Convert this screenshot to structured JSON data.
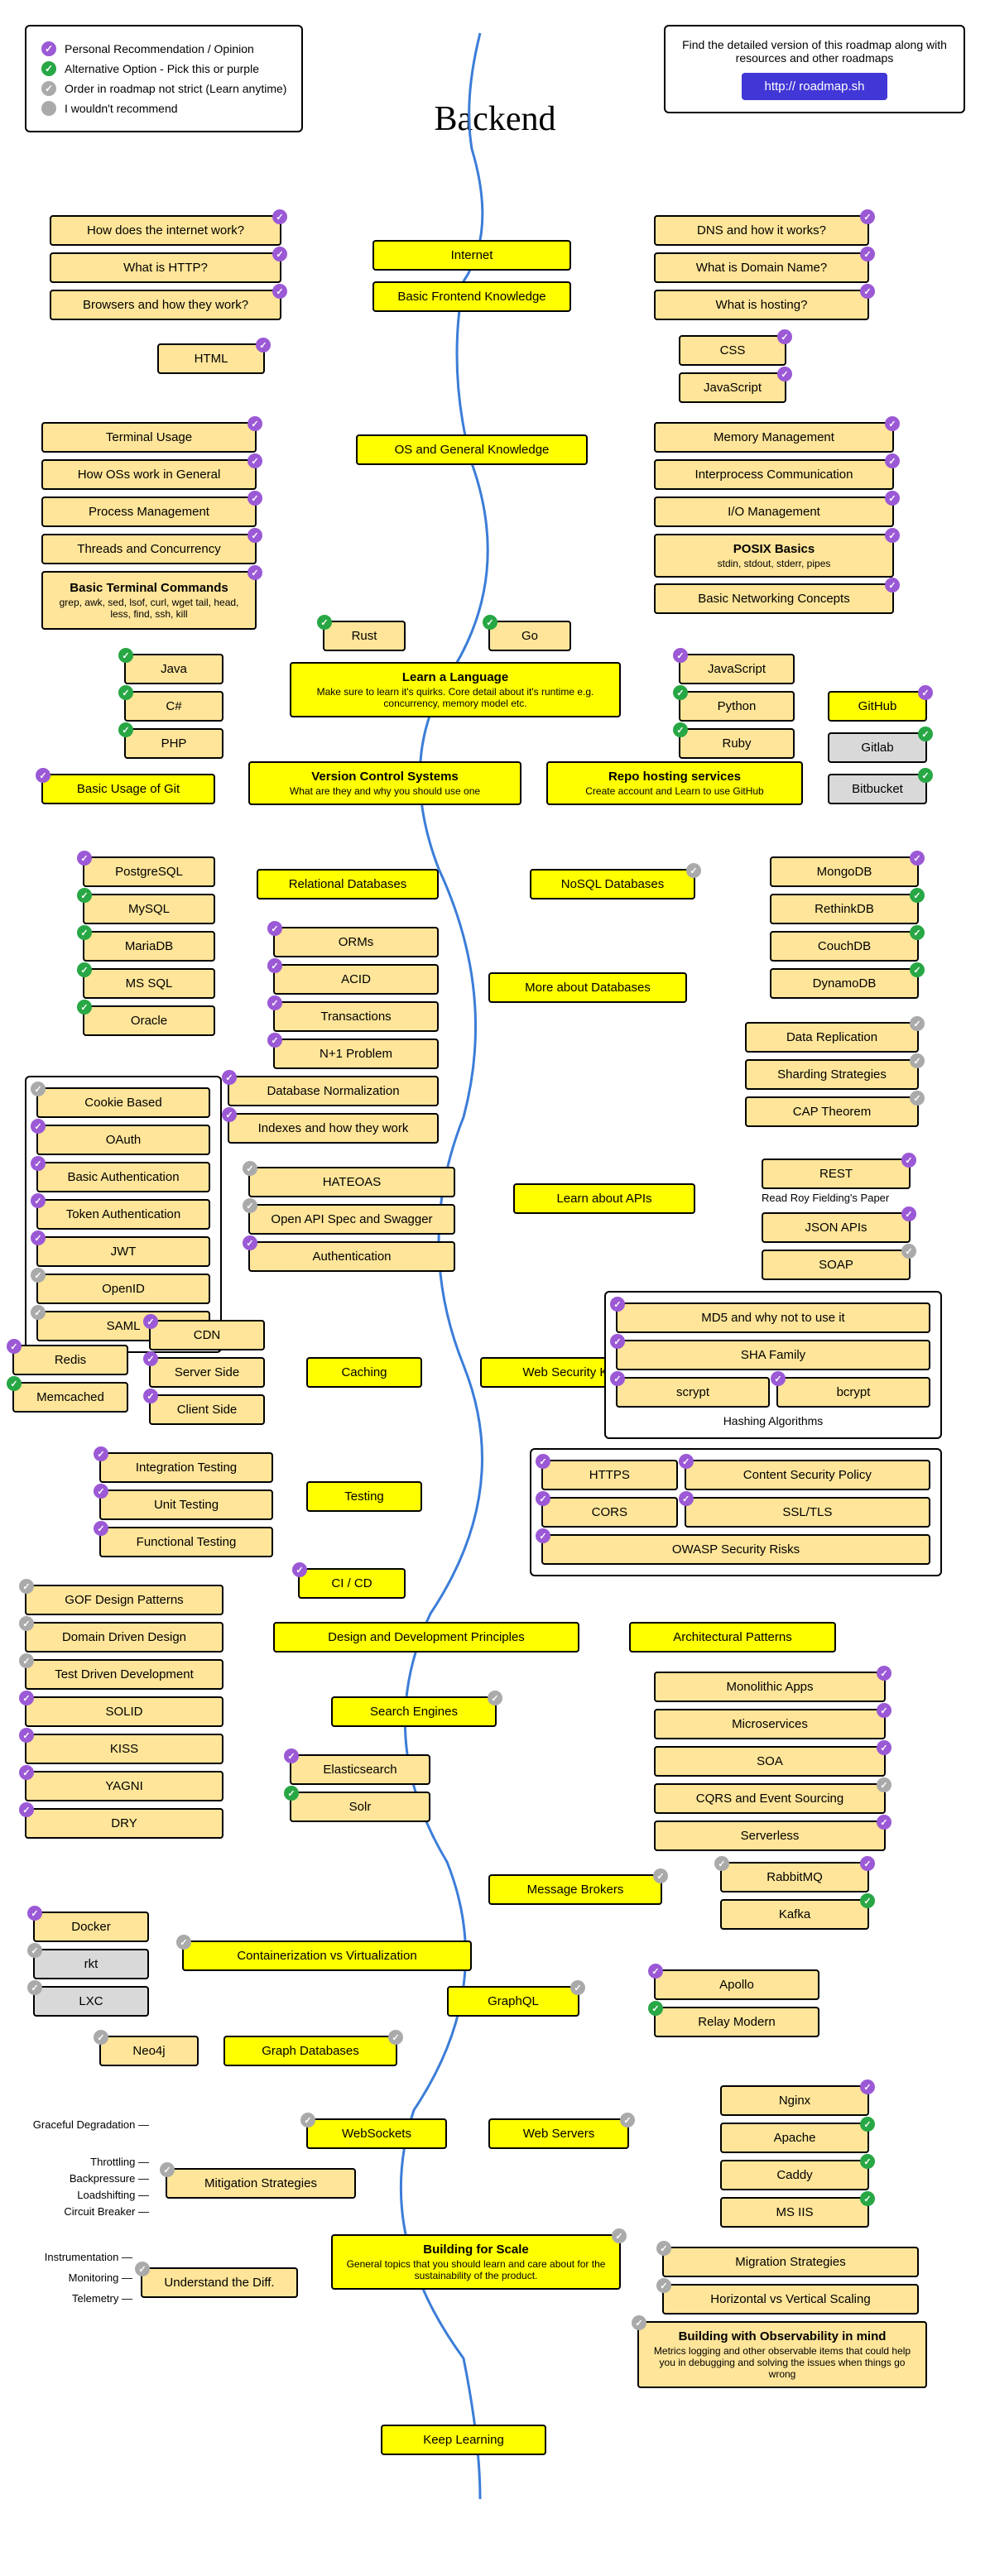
{
  "legend": {
    "items": [
      {
        "label": "Personal Recommendation / Opinion",
        "color": "purple"
      },
      {
        "label": "Alternative Option - Pick this or purple",
        "color": "green"
      },
      {
        "label": "Order in roadmap not strict (Learn anytime)",
        "color": "gray"
      },
      {
        "label": "I wouldn't recommend",
        "color": "gray"
      }
    ]
  },
  "info": {
    "text": "Find the detailed version of this roadmap along with resources and other roadmaps",
    "link": "http:// roadmap.sh"
  },
  "title": "Backend",
  "nodes": {
    "internet": "Internet",
    "how_internet": "How does the internet work?",
    "what_http": "What is HTTP?",
    "browsers": "Browsers and how they work?",
    "dns": "DNS and how it works?",
    "domain_name": "What is Domain Name?",
    "hosting": "What is hosting?",
    "basic_frontend": "Basic Frontend Knowledge",
    "html": "HTML",
    "css": "CSS",
    "js": "JavaScript",
    "os_general": "OS and General Knowledge",
    "terminal": "Terminal Usage",
    "how_os": "How OSs work in General",
    "process_mgmt": "Process Management",
    "threads": "Threads and Concurrency",
    "basic_terminal_title": "Basic Terminal Commands",
    "basic_terminal_sub": "grep, awk, sed, lsof, curl, wget tail, head, less, find, ssh, kill",
    "memory_mgmt": "Memory Management",
    "ipc": "Interprocess Communication",
    "io_mgmt": "I/O Management",
    "posix_title": "POSIX Basics",
    "posix_sub": "stdin, stdout, stderr, pipes",
    "basic_networking": "Basic Networking Concepts",
    "rust": "Rust",
    "go": "Go",
    "learn_lang_title": "Learn a Language",
    "learn_lang_sub": "Make sure to learn it's quirks. Core detail about it's runtime e.g. concurrency, memory model etc.",
    "java": "Java",
    "csharp": "C#",
    "php": "PHP",
    "js2": "JavaScript",
    "python": "Python",
    "ruby": "Ruby",
    "github": "GitHub",
    "gitlab": "Gitlab",
    "bitbucket": "Bitbucket",
    "basic_git": "Basic Usage of Git",
    "vcs_title": "Version Control Systems",
    "vcs_sub": "What are they and why you should use one",
    "repo_hosting_title": "Repo hosting services",
    "repo_hosting_sub": "Create account and Learn to use GitHub",
    "relational_db": "Relational Databases",
    "nosql_db": "NoSQL Databases",
    "postgresql": "PostgreSQL",
    "mysql": "MySQL",
    "mariadb": "MariaDB",
    "mssql": "MS SQL",
    "oracle": "Oracle",
    "mongodb": "MongoDB",
    "rethinkdb": "RethinkDB",
    "couchdb": "CouchDB",
    "dynamodb": "DynamoDB",
    "more_db": "More about Databases",
    "orms": "ORMs",
    "acid": "ACID",
    "transactions": "Transactions",
    "n1": "N+1 Problem",
    "db_normalization": "Database Normalization",
    "indexes": "Indexes and how they work",
    "data_replication": "Data Replication",
    "sharding": "Sharding Strategies",
    "cap": "CAP Theorem",
    "learn_apis": "Learn about APIs",
    "rest": "REST",
    "rest_sub": "Read Roy Fielding's Paper",
    "json_apis": "JSON APIs",
    "soap": "SOAP",
    "hateoas": "HATEOAS",
    "openapi": "Open API Spec and Swagger",
    "authentication": "Authentication",
    "cookie": "Cookie Based",
    "oauth": "OAuth",
    "basic_auth": "Basic Authentication",
    "token_auth": "Token Authentication",
    "jwt": "JWT",
    "openid": "OpenID",
    "saml": "SAML",
    "caching": "Caching",
    "cdn": "CDN",
    "server_side": "Server Side",
    "client_side": "Client Side",
    "redis": "Redis",
    "memcached": "Memcached",
    "web_security": "Web Security Knowledge",
    "md5": "MD5 and why not to use it",
    "sha": "SHA Family",
    "scrypt": "scrypt",
    "bcrypt": "bcrypt",
    "hashing_label": "Hashing Algorithms",
    "https": "HTTPS",
    "cors": "CORS",
    "csp": "Content Security Policy",
    "ssl": "SSL/TLS",
    "owasp": "OWASP Security Risks",
    "testing": "Testing",
    "integration_test": "Integration Testing",
    "unit_test": "Unit Testing",
    "functional_test": "Functional Testing",
    "cicd": "CI / CD",
    "design_principles": "Design and Development Principles",
    "gof": "GOF Design Patterns",
    "ddd": "Domain Driven Design",
    "tdd": "Test Driven Development",
    "solid": "SOLID",
    "kiss": "KISS",
    "yagni": "YAGNI",
    "dry": "DRY",
    "arch_patterns": "Architectural Patterns",
    "monolithic": "Monolithic Apps",
    "microservices": "Microservices",
    "soa": "SOA",
    "cqrs": "CQRS and Event Sourcing",
    "serverless": "Serverless",
    "search_engines": "Search Engines",
    "elasticsearch": "Elasticsearch",
    "solr": "Solr",
    "message_brokers": "Message Brokers",
    "rabbitmq": "RabbitMQ",
    "kafka": "Kafka",
    "containerization": "Containerization vs Virtualization",
    "docker": "Docker",
    "rkt": "rkt",
    "lxc": "LXC",
    "graphql": "GraphQL",
    "apollo": "Apollo",
    "relay": "Relay Modern",
    "graph_db": "Graph Databases",
    "neo4j": "Neo4j",
    "websockets": "WebSockets",
    "web_servers": "Web Servers",
    "nginx": "Nginx",
    "apache": "Apache",
    "caddy": "Caddy",
    "msiis": "MS IIS",
    "building_scale_title": "Building for Scale",
    "building_scale_sub": "General topics that you should learn and care about for the sustainability of the product.",
    "mitigation": "Mitigation Strategies",
    "understand_diff": "Understand the Diff.",
    "migration": "Migration Strategies",
    "horizontal_vertical": "Horizontal vs Vertical Scaling",
    "observability_title": "Building with Observability in mind",
    "observability_sub": "Metrics logging and other observable items that could help you in debugging and solving the issues when things go wrong",
    "keep_learning": "Keep Learning",
    "graceful": "Graceful Degradation",
    "throttling": "Throttling",
    "backpressure": "Backpressure",
    "loadshifting": "Loadshifting",
    "circuit_breaker": "Circuit Breaker",
    "instrumentation": "Instrumentation",
    "monitoring": "Monitoring",
    "telemetry": "Telemetry"
  }
}
